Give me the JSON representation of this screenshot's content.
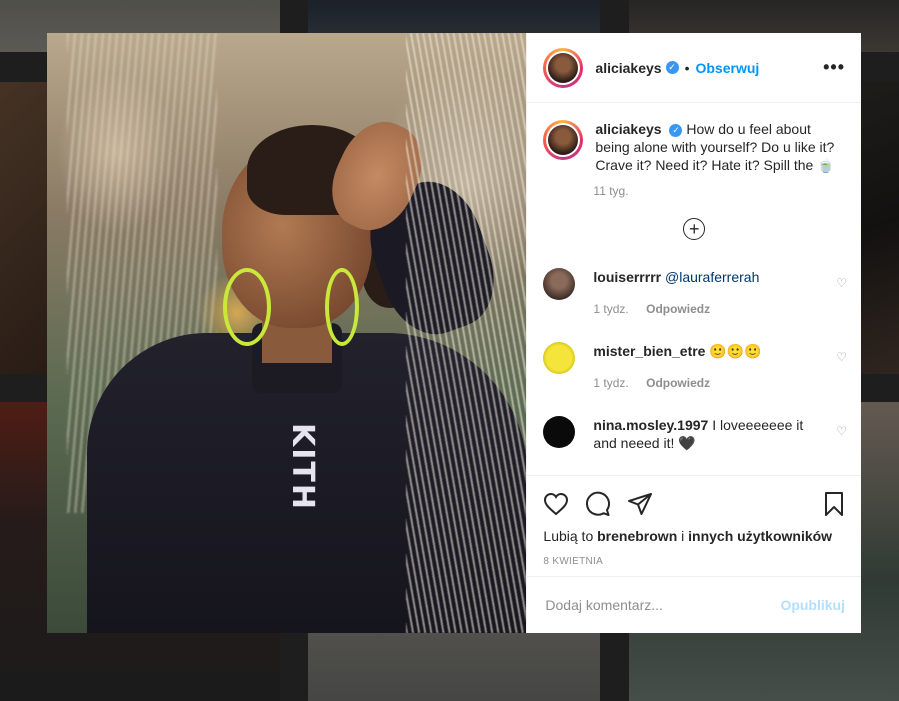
{
  "post": {
    "username": "aliciakeys",
    "follow_label": "Obserwuj",
    "dot": "•",
    "more_icon": "more-options-icon",
    "verified_symbol": "✓",
    "caption": {
      "username": "aliciakeys",
      "text": "How do u feel about being alone with yourself? Do u like it? Crave it? Need it? Hate it? Spill the 🍵",
      "time": "11 tyg."
    },
    "load_more_symbol": "+",
    "photo_text": "KITH",
    "comments": [
      {
        "username": "louiserrrrr",
        "mention": "@lauraferrerah",
        "text": "",
        "time": "1 tydz.",
        "reply_label": "Odpowiedz",
        "avatar_color": "#5a4a44"
      },
      {
        "username": "mister_bien_etre",
        "mention": "",
        "text": "🙂🙂🙂",
        "time": "1 tydz.",
        "reply_label": "Odpowiedz",
        "avatar_color": "#f2e035"
      },
      {
        "username": "nina.mosley.1997",
        "mention": "",
        "text": "I loveeeeeee it and neeed it! 🖤",
        "time": "",
        "reply_label": "",
        "avatar_color": "#0a0a0a"
      }
    ],
    "heart_symbol": "♡",
    "likes": {
      "prefix": "Lubią to",
      "user": "brenebrown",
      "connector": "i",
      "others": "innych użytkowników"
    },
    "date": "8 KWIETNIA",
    "add_comment": {
      "placeholder": "Dodaj komentarz...",
      "post_label": "Opublikuj"
    }
  },
  "colors": {
    "accent": "#0095f6",
    "verified": "#3897f0",
    "muted": "#8e8e8e",
    "post_disabled": "#b2dffc"
  }
}
